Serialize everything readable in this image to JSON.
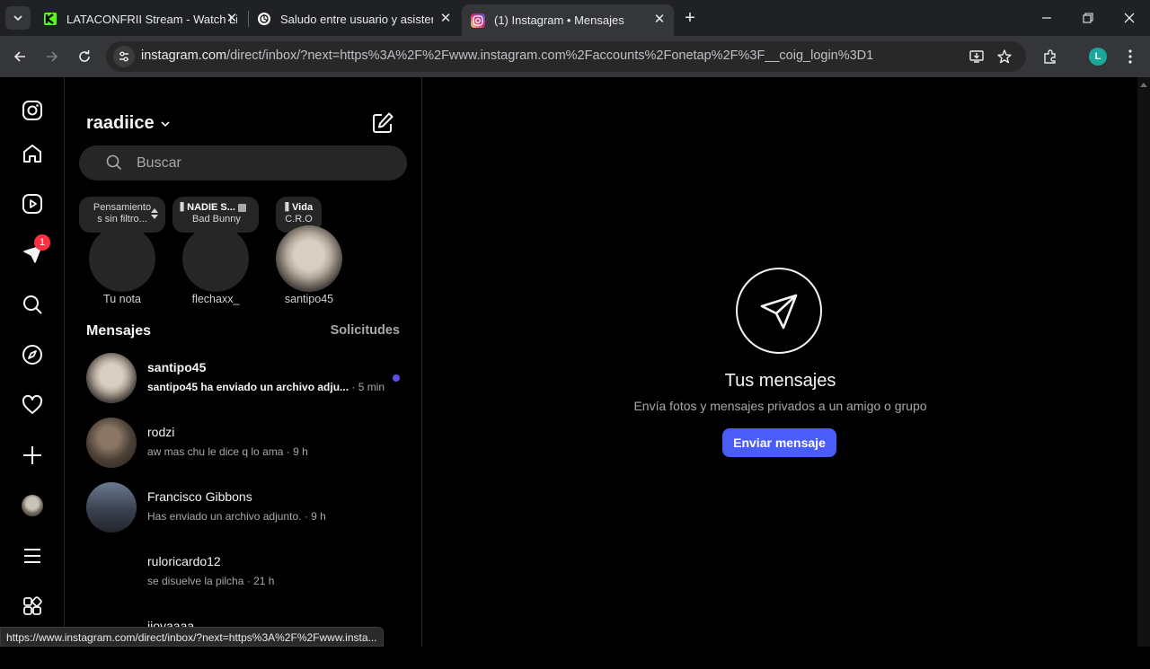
{
  "browser": {
    "tabs": [
      {
        "title": "LATACONFRII Stream - Watch Li",
        "favicon": "kick-icon"
      },
      {
        "title": "Saludo entre usuario y asistente",
        "favicon": "chatgpt-icon"
      },
      {
        "title": "(1) Instagram • Mensajes",
        "favicon": "instagram-icon",
        "active": true
      }
    ],
    "url_host": "instagram.com",
    "url_rest": "/direct/inbox/?next=https%3A%2F%2Fwww.instagram.com%2Faccounts%2Fonetap%2F%3F__coig_login%3D1",
    "profile_initial": "L",
    "status_url": "https://www.instagram.com/direct/inbox/?next=https%3A%2F%2Fwww.insta..."
  },
  "nav": {
    "notification_count": "1"
  },
  "inbox": {
    "username": "raadiice",
    "search_placeholder": "Buscar",
    "notes": [
      {
        "bubble_line1": "Pensamiento",
        "bubble_line2": "s sin filtro...",
        "name": "Tu nota"
      },
      {
        "bubble_line1": "NADIE S...",
        "bubble_line2": "Bad Bunny",
        "name": "flechaxx_"
      },
      {
        "bubble_line1": "Vida",
        "bubble_line2": "C.R.O",
        "name": "santipo45"
      }
    ],
    "section_title": "Mensajes",
    "requests_label": "Solicitudes",
    "threads": [
      {
        "name": "santipo45",
        "preview": "santipo45 ha enviado un archivo adju...",
        "time": "· 5 min",
        "unread": true
      },
      {
        "name": "rodzi",
        "preview": "aw mas chu le dice q lo ama",
        "time": "· 9 h"
      },
      {
        "name": "Francisco Gibbons",
        "preview": "Has enviado un archivo adjunto.",
        "time": "· 9 h"
      },
      {
        "name": "ruloricardo12",
        "preview": "se disuelve la pilcha",
        "time": "· 21 h"
      },
      {
        "name": "jjoyaaaa",
        "preview": "",
        "time": ""
      }
    ]
  },
  "main": {
    "title": "Tus mensajes",
    "subtitle": "Envía fotos y mensajes privados a un amigo o grupo",
    "button": "Enviar mensaje"
  },
  "colors": {
    "accent": "#4a5df9",
    "unread_dot": "#5b51f0",
    "notification": "#ff3040"
  }
}
